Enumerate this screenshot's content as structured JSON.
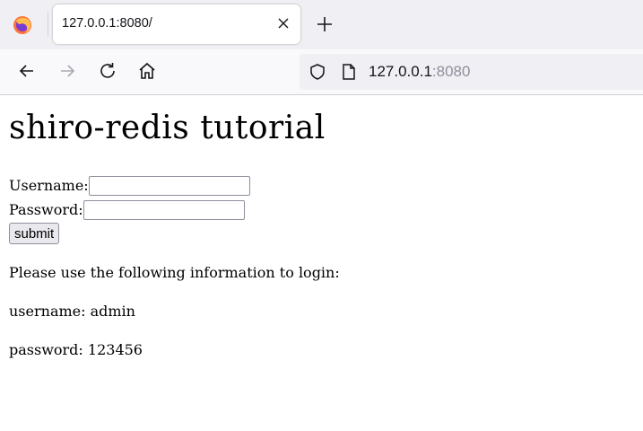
{
  "browser": {
    "tab_title": "127.0.0.1:8080/",
    "url_host": "127.0.0.1",
    "url_port": ":8080",
    "icons": {
      "app": "firefox-icon",
      "close": "close-icon",
      "new_tab": "plus-icon",
      "back": "back-arrow-icon",
      "forward": "forward-arrow-icon",
      "reload": "reload-icon",
      "home": "home-icon",
      "shield": "shield-icon",
      "page": "page-icon"
    }
  },
  "page": {
    "heading": "shiro-redis tutorial",
    "form": {
      "username_label": "Username:",
      "username_value": "",
      "password_label": "Password:",
      "password_value": "",
      "submit_label": "submit"
    },
    "info": {
      "intro": "Please use the following information to login:",
      "username_line": "username: admin",
      "password_line": "password: 123456"
    }
  }
}
